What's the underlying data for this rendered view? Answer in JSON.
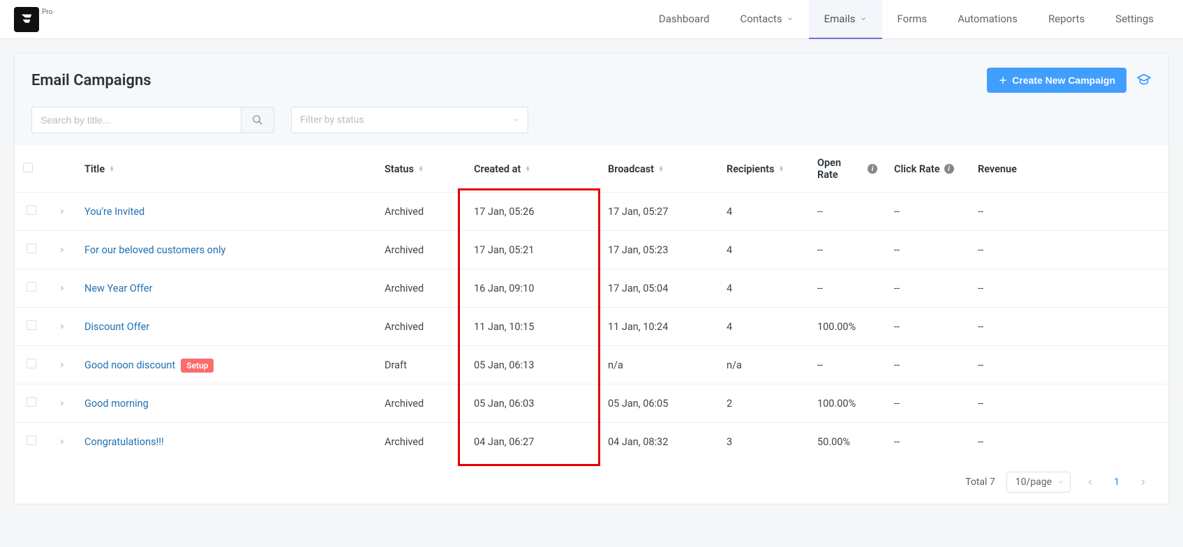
{
  "brand": {
    "pro": "Pro"
  },
  "nav": {
    "items": [
      {
        "label": "Dashboard",
        "hasChevron": false
      },
      {
        "label": "Contacts",
        "hasChevron": true
      },
      {
        "label": "Emails",
        "hasChevron": true,
        "active": true
      },
      {
        "label": "Forms",
        "hasChevron": false
      },
      {
        "label": "Automations",
        "hasChevron": false
      },
      {
        "label": "Reports",
        "hasChevron": false
      },
      {
        "label": "Settings",
        "hasChevron": false
      }
    ]
  },
  "header": {
    "title": "Email Campaigns",
    "createBtn": "Create New Campaign"
  },
  "filters": {
    "searchPlaceholder": "Search by title...",
    "statusPlaceholder": "Filter by status"
  },
  "table": {
    "columns": {
      "title": "Title",
      "status": "Status",
      "created": "Created at",
      "broadcast": "Broadcast",
      "recipients": "Recipients",
      "openRate": "Open Rate",
      "clickRate": "Click Rate",
      "revenue": "Revenue"
    },
    "rows": [
      {
        "title": "You're Invited",
        "setup": false,
        "status": "Archived",
        "created": "17 Jan, 05:26",
        "broadcast": "17 Jan, 05:27",
        "recipients": "4",
        "openRate": "--",
        "clickRate": "--",
        "revenue": "--"
      },
      {
        "title": "For our beloved customers only",
        "setup": false,
        "status": "Archived",
        "created": "17 Jan, 05:21",
        "broadcast": "17 Jan, 05:23",
        "recipients": "4",
        "openRate": "--",
        "clickRate": "--",
        "revenue": "--"
      },
      {
        "title": "New Year Offer",
        "setup": false,
        "status": "Archived",
        "created": "16 Jan, 09:10",
        "broadcast": "17 Jan, 05:04",
        "recipients": "4",
        "openRate": "--",
        "clickRate": "--",
        "revenue": "--"
      },
      {
        "title": "Discount Offer",
        "setup": false,
        "status": "Archived",
        "created": "11 Jan, 10:15",
        "broadcast": "11 Jan, 10:24",
        "recipients": "4",
        "openRate": "100.00%",
        "clickRate": "--",
        "revenue": "--"
      },
      {
        "title": "Good noon discount",
        "setup": true,
        "setupLabel": "Setup",
        "status": "Draft",
        "created": "05 Jan, 06:13",
        "broadcast": "n/a",
        "recipients": "n/a",
        "openRate": "--",
        "clickRate": "--",
        "revenue": "--"
      },
      {
        "title": "Good morning",
        "setup": false,
        "status": "Archived",
        "created": "05 Jan, 06:03",
        "broadcast": "05 Jan, 06:05",
        "recipients": "2",
        "openRate": "100.00%",
        "clickRate": "--",
        "revenue": "--"
      },
      {
        "title": "Congratulations!!!",
        "setup": false,
        "status": "Archived",
        "created": "04 Jan, 06:27",
        "broadcast": "04 Jan, 08:32",
        "recipients": "3",
        "openRate": "50.00%",
        "clickRate": "--",
        "revenue": "--"
      }
    ]
  },
  "pagination": {
    "totalLabel": "Total 7",
    "pageSize": "10/page",
    "current": "1"
  }
}
